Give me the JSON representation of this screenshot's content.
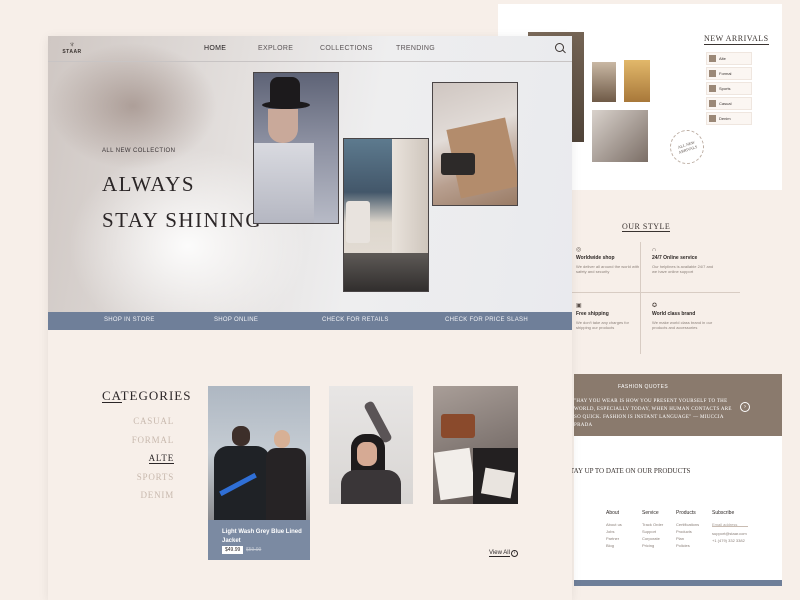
{
  "nav": {
    "logo_mark": "♆",
    "logo_text": "STAAR",
    "links": [
      "HOME",
      "EXPLORE",
      "COLLECTIONS",
      "TRENDING"
    ],
    "active": "HOME",
    "search_icon": "search-icon"
  },
  "hero": {
    "subtitle": "ALL NEW COLLECTION",
    "title_line1": "ALWAYS",
    "title_line2": "STAY SHINING"
  },
  "shop_bar": {
    "links": [
      "SHOP IN STORE",
      "SHOP ONLINE",
      "CHECK FOR RETAILS",
      "CHECK FOR PRICE SLASH"
    ],
    "color": "#6f7f99"
  },
  "categories": {
    "title": "CATEGORIES",
    "items": [
      "CASUAL",
      "FORMAL",
      "ALTE",
      "SPORTS",
      "DENIM"
    ],
    "active": "ALTE"
  },
  "products": {
    "featured_name": "Light Wash Grey Blue Lined Jacket",
    "featured_price": "$49.99",
    "featured_old_price": "$59.99",
    "view_all": "View All"
  },
  "back_page": {
    "new_arrivals_title": "NEW ARRIVALS",
    "new_arrivals": [
      "Alte",
      "Formal",
      "Sports",
      "Casual",
      "Denim"
    ],
    "stamp_text": "ALL NEW ARRIVALS",
    "our_style_title": "OUR STYLE",
    "features": [
      {
        "icon": "globe-icon",
        "title": "Worldwide shop",
        "text": "We deliver all around the world with safety and security"
      },
      {
        "icon": "headset-icon",
        "title": "24/7 Online service",
        "text": "Our helplines is available 24/7 and we have online support"
      },
      {
        "icon": "ship-icon",
        "title": "Free shipping",
        "text": "We don't take any charges for shipping our products"
      },
      {
        "icon": "badge-icon",
        "title": "World class brand",
        "text": "We make world class brand in our products and accessories"
      }
    ],
    "quote_title": "FASHION QUOTES",
    "quote_text": "\"HAY YOU WEAR IS HOW YOU PRESENT YOURSELF TO THE WORLD, ESPECIALLY TODAY, WHEN HUMAN CONTACTS ARE SO QUICK. FASHION IS INSTANT LANGUAGE\" — MIUCCIA PRADA",
    "footer_head": "STAY UP TO DATE ON OUR PRODUCTS",
    "footer_cols": [
      {
        "title": "About",
        "items": [
          "About us",
          "Jobs",
          "Partner",
          "Blog"
        ]
      },
      {
        "title": "Service",
        "items": [
          "Track Order",
          "Support",
          "Corporate",
          "Pricing"
        ]
      },
      {
        "title": "Products",
        "items": [
          "Certifications",
          "Products",
          "Plan",
          "Policies"
        ]
      },
      {
        "title": "Subscribe",
        "items": [
          "support@staar.com",
          "+1 (479) 332 3382"
        ]
      }
    ],
    "email_placeholder": "Email address"
  }
}
